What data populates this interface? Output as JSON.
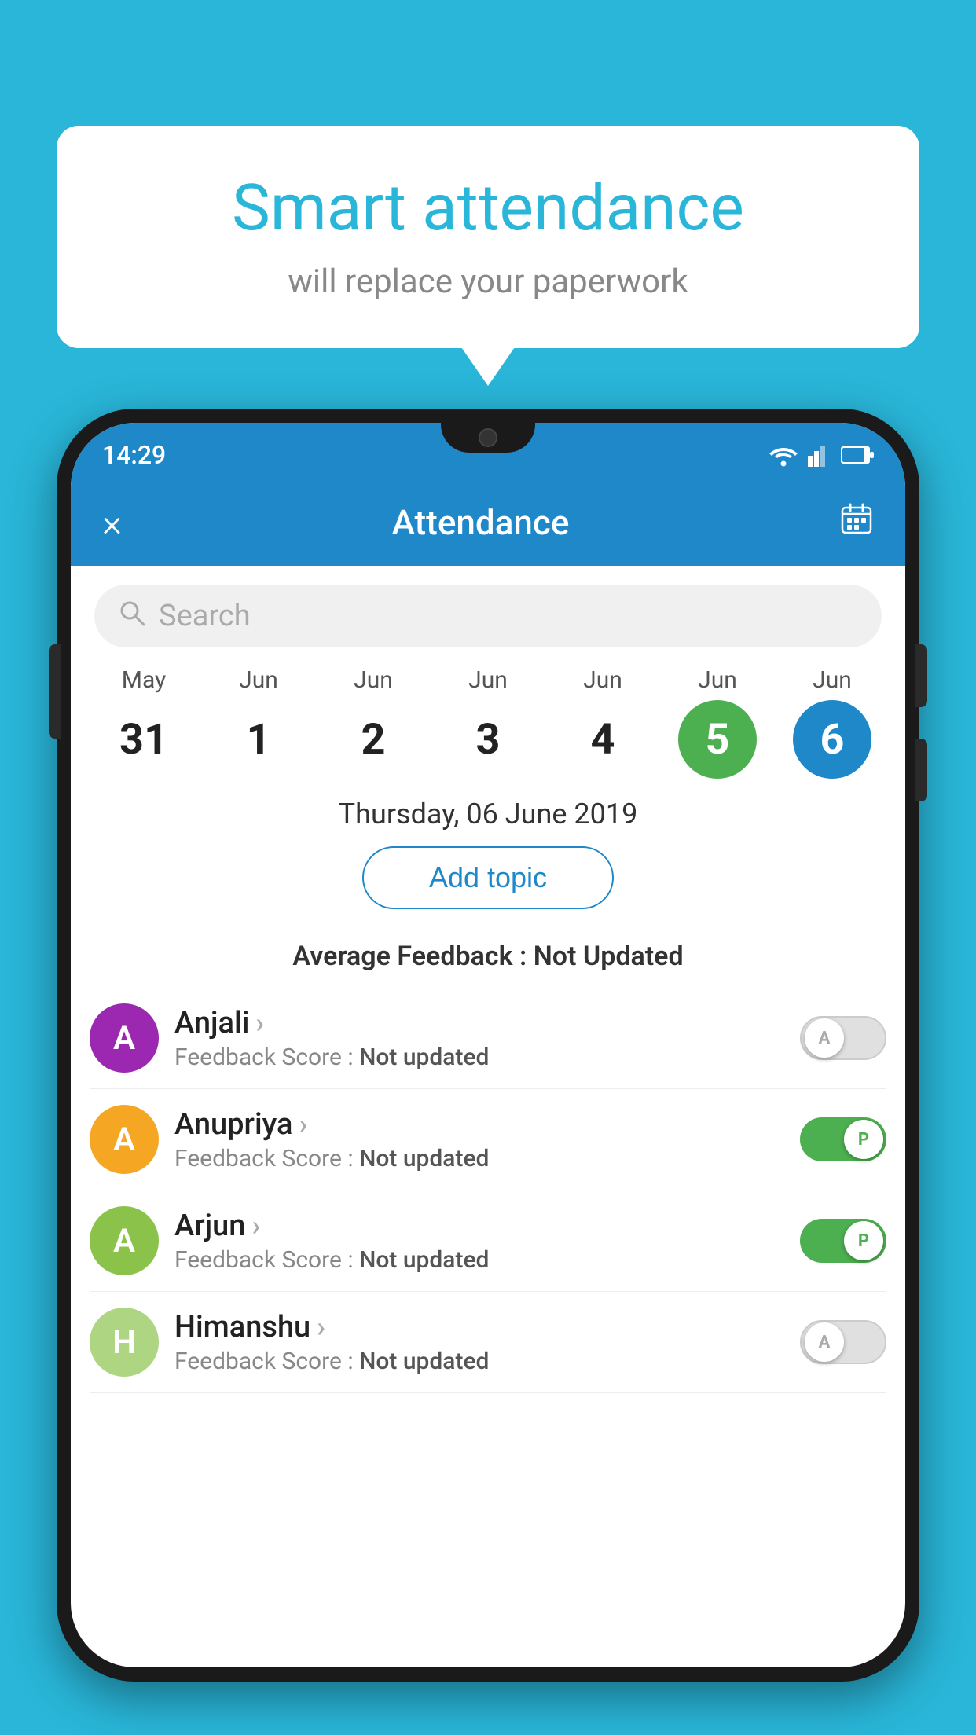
{
  "background_color": "#29b6d9",
  "speech_bubble": {
    "title": "Smart attendance",
    "subtitle": "will replace your paperwork"
  },
  "status_bar": {
    "time": "14:29",
    "icons": [
      "wifi",
      "signal",
      "battery"
    ]
  },
  "header": {
    "title": "Attendance",
    "close_label": "×",
    "calendar_icon": "📅"
  },
  "search": {
    "placeholder": "Search"
  },
  "dates": [
    {
      "month": "May",
      "day": "31",
      "selected": false,
      "today": false
    },
    {
      "month": "Jun",
      "day": "1",
      "selected": false,
      "today": false
    },
    {
      "month": "Jun",
      "day": "2",
      "selected": false,
      "today": false
    },
    {
      "month": "Jun",
      "day": "3",
      "selected": false,
      "today": false
    },
    {
      "month": "Jun",
      "day": "4",
      "selected": false,
      "today": false
    },
    {
      "month": "Jun",
      "day": "5",
      "selected": false,
      "today": true
    },
    {
      "month": "Jun",
      "day": "6",
      "selected": true,
      "today": false
    }
  ],
  "selected_date": "Thursday, 06 June 2019",
  "add_topic_label": "Add topic",
  "avg_feedback": {
    "label": "Average Feedback : ",
    "value": "Not Updated"
  },
  "students": [
    {
      "name": "Anjali",
      "initials": "A",
      "avatar_color": "#9c27b0",
      "feedback_label": "Feedback Score : ",
      "feedback_value": "Not updated",
      "toggle_state": "off",
      "toggle_label": "A"
    },
    {
      "name": "Anupriya",
      "initials": "A",
      "avatar_color": "#f5a623",
      "feedback_label": "Feedback Score : ",
      "feedback_value": "Not updated",
      "toggle_state": "on",
      "toggle_label": "P"
    },
    {
      "name": "Arjun",
      "initials": "A",
      "avatar_color": "#8bc34a",
      "feedback_label": "Feedback Score : ",
      "feedback_value": "Not updated",
      "toggle_state": "on",
      "toggle_label": "P"
    },
    {
      "name": "Himanshu",
      "initials": "H",
      "avatar_color": "#aed581",
      "feedback_label": "Feedback Score : ",
      "feedback_value": "Not updated",
      "toggle_state": "off",
      "toggle_label": "A"
    }
  ]
}
